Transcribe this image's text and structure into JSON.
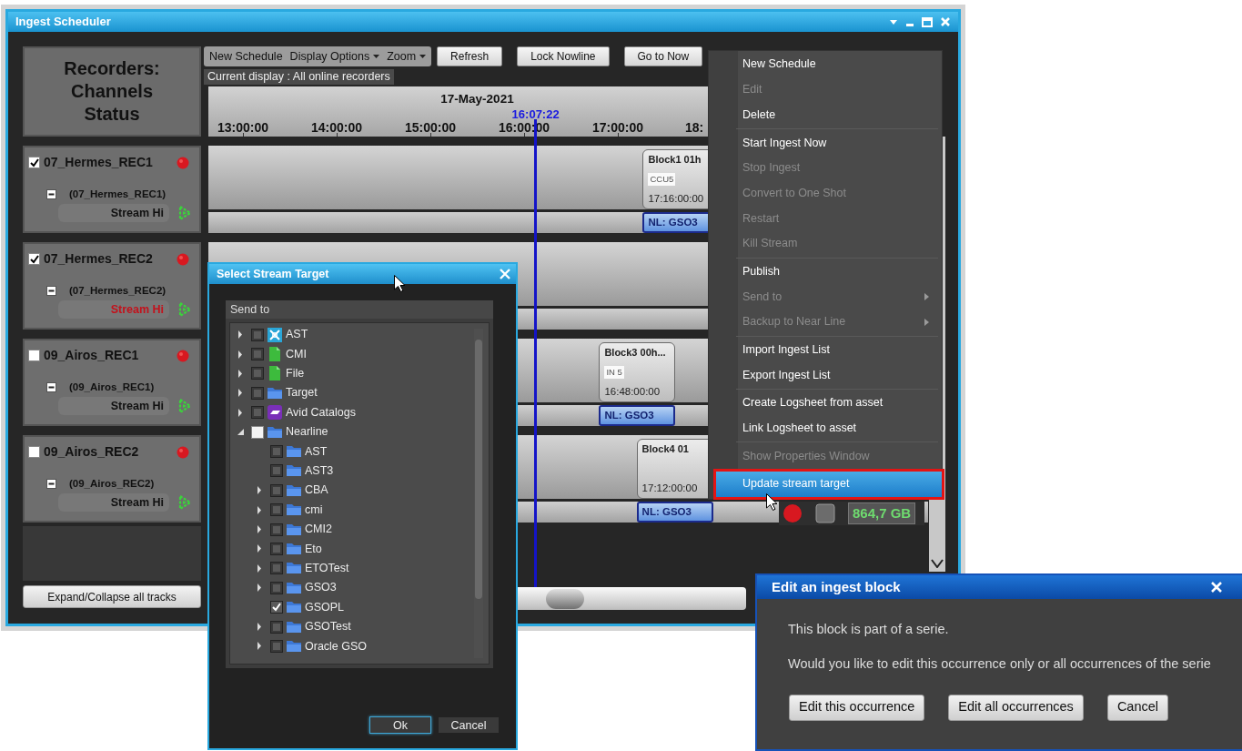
{
  "window": {
    "title": "Ingest Scheduler"
  },
  "recorders_heading": "Recorders: Channels Status",
  "toolbar": {
    "menus": [
      {
        "label": "New Schedule",
        "dropdown": false
      },
      {
        "label": "Display Options",
        "dropdown": true
      },
      {
        "label": "Zoom",
        "dropdown": true
      }
    ],
    "buttons": [
      "Refresh",
      "Lock Nowline",
      "Go to Now"
    ]
  },
  "current_display": "Current display : All online recorders",
  "timeline": {
    "date": "17-May-2021",
    "ticks": [
      "13:00:00",
      "14:00:00",
      "15:00:00",
      "16:00:00",
      "17:00:00",
      "18:"
    ],
    "now": "16:07:22"
  },
  "recorders": [
    {
      "name": "07_Hermes_REC1",
      "checked": true,
      "channel": "(07_Hermes_REC1)",
      "stream": "Stream Hi",
      "stream_error": false,
      "blocks": [
        {
          "title": "Block1 01h",
          "source": "CCU5",
          "start": "17:16:00:00",
          "target": "NL: GSO3"
        }
      ]
    },
    {
      "name": "07_Hermes_REC2",
      "checked": true,
      "channel": "(07_Hermes_REC2)",
      "stream": "Stream Hi",
      "stream_error": true
    },
    {
      "name": "09_Airos_REC1",
      "checked": false,
      "channel": "(09_Airos_REC1)",
      "stream": "Stream Hi",
      "stream_error": false,
      "blocks": [
        {
          "title": "Block3 00h...",
          "source": "IN 5",
          "start": "16:48:00:00",
          "target": "NL: GSO3"
        }
      ]
    },
    {
      "name": "09_Airos_REC2",
      "checked": false,
      "channel": "(09_Airos_REC2)",
      "stream": "Stream Hi",
      "stream_error": false,
      "blocks": [
        {
          "title": "Block4 01",
          "start": "17:12:00:00",
          "target": "NL: GSO3"
        }
      ],
      "storage": "864,7 GB"
    }
  ],
  "expand_button": "Expand/Collapse all tracks",
  "stream_dialog": {
    "title": "Select Stream Target",
    "section": "Send to",
    "tree": [
      {
        "label": "AST",
        "kind": "ast",
        "checked": false,
        "partial": false,
        "has_children": true,
        "expanded": false
      },
      {
        "label": "CMI",
        "kind": "doc",
        "checked": false,
        "partial": false,
        "has_children": true,
        "expanded": false
      },
      {
        "label": "File",
        "kind": "doc",
        "checked": false,
        "partial": false,
        "has_children": true,
        "expanded": false
      },
      {
        "label": "Target",
        "kind": "folder",
        "checked": false,
        "partial": false,
        "has_children": true,
        "expanded": false
      },
      {
        "label": "Avid Catalogs",
        "kind": "avid",
        "checked": false,
        "partial": false,
        "has_children": true,
        "expanded": false
      },
      {
        "label": "Nearline",
        "kind": "folder",
        "checked": false,
        "partial": true,
        "has_children": true,
        "expanded": true,
        "children": [
          {
            "label": "AST",
            "kind": "folder",
            "checked": false,
            "partial": false,
            "has_children": false
          },
          {
            "label": "AST3",
            "kind": "folder",
            "checked": false,
            "partial": false,
            "has_children": false
          },
          {
            "label": "CBA",
            "kind": "folder",
            "checked": false,
            "partial": false,
            "has_children": true,
            "expanded": false
          },
          {
            "label": "cmi",
            "kind": "folder",
            "checked": false,
            "partial": false,
            "has_children": true,
            "expanded": false
          },
          {
            "label": "CMI2",
            "kind": "folder",
            "checked": false,
            "partial": false,
            "has_children": true,
            "expanded": false
          },
          {
            "label": "Eto",
            "kind": "folder",
            "checked": false,
            "partial": false,
            "has_children": true,
            "expanded": false
          },
          {
            "label": "ETOTest",
            "kind": "folder",
            "checked": false,
            "partial": false,
            "has_children": true,
            "expanded": false
          },
          {
            "label": "GSO3",
            "kind": "folder",
            "checked": false,
            "partial": false,
            "has_children": true,
            "expanded": false
          },
          {
            "label": "GSOPL",
            "kind": "folder",
            "checked": true,
            "partial": false,
            "has_children": false
          },
          {
            "label": "GSOTest",
            "kind": "folder",
            "checked": false,
            "partial": false,
            "has_children": true,
            "expanded": false
          },
          {
            "label": "Oracle GSO",
            "kind": "folder",
            "checked": false,
            "partial": false,
            "has_children": true,
            "expanded": false
          }
        ]
      }
    ],
    "buttons": [
      {
        "label": "Ok",
        "focused": true
      },
      {
        "label": "Cancel",
        "focused": false
      }
    ]
  },
  "context_menu": {
    "groups": [
      [
        {
          "label": "New Schedule",
          "disabled": false,
          "submenu": false,
          "selected": false
        },
        {
          "label": "Edit",
          "disabled": true,
          "submenu": false,
          "selected": false
        },
        {
          "label": "Delete",
          "disabled": false,
          "submenu": false,
          "selected": false
        }
      ],
      [
        {
          "label": "Start Ingest Now",
          "disabled": false,
          "submenu": false,
          "selected": false
        },
        {
          "label": "Stop Ingest",
          "disabled": true,
          "submenu": false,
          "selected": false
        },
        {
          "label": "Convert to One Shot",
          "disabled": true,
          "submenu": false,
          "selected": false
        },
        {
          "label": "Restart",
          "disabled": true,
          "submenu": false,
          "selected": false
        },
        {
          "label": "Kill Stream",
          "disabled": true,
          "submenu": false,
          "selected": false
        }
      ],
      [
        {
          "label": "Publish",
          "disabled": false,
          "submenu": false,
          "selected": false
        },
        {
          "label": "Send to",
          "disabled": true,
          "submenu": true,
          "selected": false
        },
        {
          "label": "Backup to Near Line",
          "disabled": true,
          "submenu": true,
          "selected": false
        }
      ],
      [
        {
          "label": "Import Ingest List",
          "disabled": false,
          "submenu": false,
          "selected": false
        },
        {
          "label": "Export Ingest List",
          "disabled": false,
          "submenu": false,
          "selected": false
        }
      ],
      [
        {
          "label": "Create Logsheet from asset",
          "disabled": false,
          "submenu": false,
          "selected": false
        },
        {
          "label": "Link Logsheet to asset",
          "disabled": false,
          "submenu": false,
          "selected": false
        }
      ],
      [
        {
          "label": "Show Properties Window",
          "disabled": true,
          "submenu": false,
          "selected": false
        }
      ],
      [
        {
          "label": "Update stream target",
          "disabled": false,
          "submenu": false,
          "selected": true
        }
      ]
    ]
  },
  "edit_dialog": {
    "title": "Edit an ingest block",
    "lines": [
      "This block is part of a serie.",
      "Would you like to edit this occurrence only or all occurrences of the serie"
    ],
    "buttons": [
      "Edit this occurrence",
      "Edit all occurrences",
      "Cancel"
    ]
  }
}
